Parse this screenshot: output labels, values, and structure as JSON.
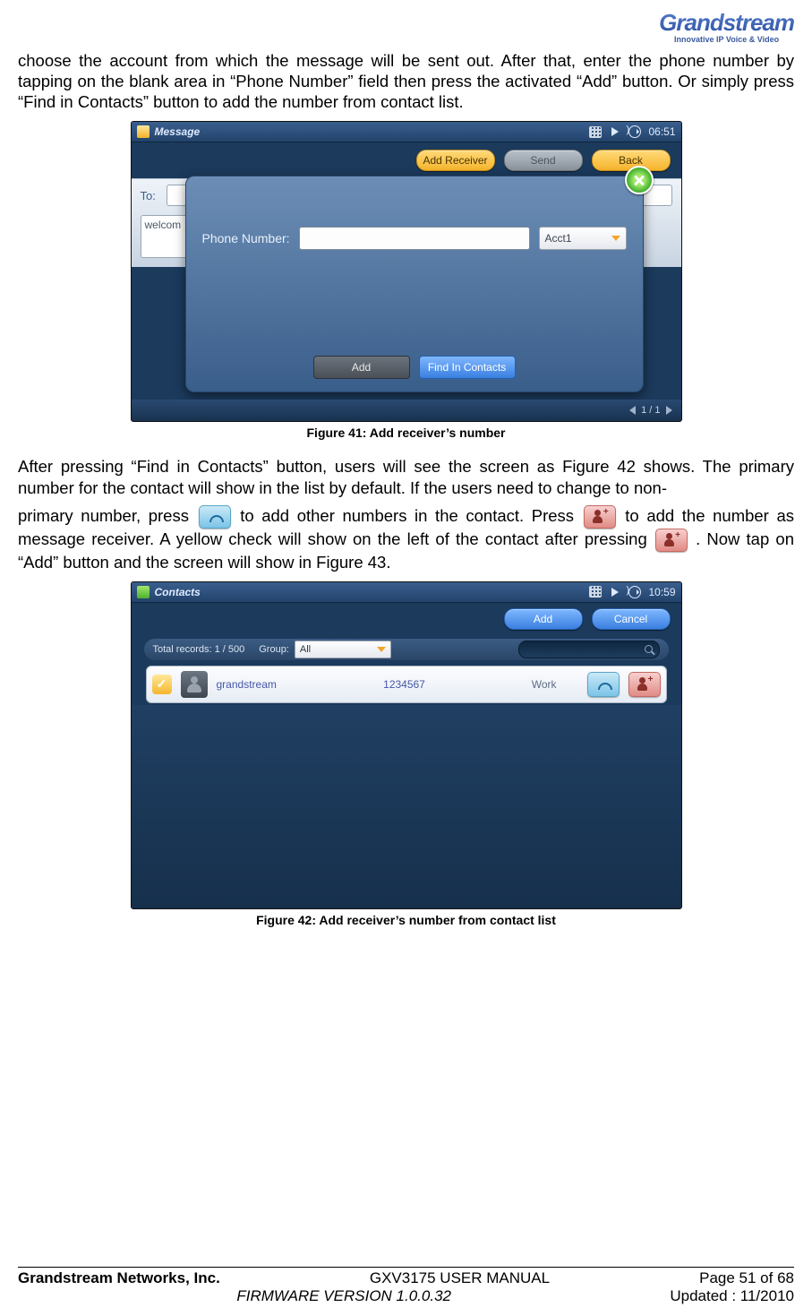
{
  "logo": {
    "brand": "Grandstream",
    "tagline": "Innovative IP Voice & Video"
  },
  "para1": "choose the account from which the message will be sent out. After that, enter the phone number by tapping on the blank area in “Phone Number” field then press the activated “Add” button. Or simply press “Find in Contacts” button to add the number from contact list.",
  "fig41": {
    "title": "Message",
    "clock": "06:51",
    "buttons": {
      "add_receiver": "Add Receiver",
      "send": "Send",
      "back": "Back"
    },
    "to_label": "To:",
    "textarea_text": "welcom",
    "pop": {
      "phone_label": "Phone Number:",
      "acct": "Acct1",
      "add": "Add",
      "find": "Find In Contacts"
    },
    "pager": "1 / 1",
    "caption": "Figure 41: Add receiver’s number"
  },
  "para2a": "After pressing “Find in Contacts” button, users will see the screen as Figure 42 shows. The primary number for the contact will show in the list by default. If the users need to change to non-",
  "para2b": "primary number, press ",
  "para2c": " to add other numbers in the contact. Press ",
  "para2d": " to add the number ",
  "para2e": "as message receiver. A yellow check will show on the left of the contact after pressing ",
  "para2f": ". Now tap on “Add” button and the screen will show in Figure 43.",
  "fig42": {
    "title": "Contacts",
    "clock": "10:59",
    "buttons": {
      "add": "Add",
      "cancel": "Cancel"
    },
    "records_label": "Total records: 1 / 500",
    "group_label": "Group:",
    "group_value": "All",
    "row": {
      "name": "grandstream",
      "number": "1234567",
      "type": "Work"
    },
    "caption": "Figure 42: Add receiver’s number from contact list"
  },
  "footer": {
    "company": "Grandstream Networks, Inc.",
    "manual": "GXV3175 USER MANUAL",
    "page": "Page 51 of 68",
    "firmware": "FIRMWARE VERSION 1.0.0.32",
    "updated": "Updated : 11/2010"
  }
}
